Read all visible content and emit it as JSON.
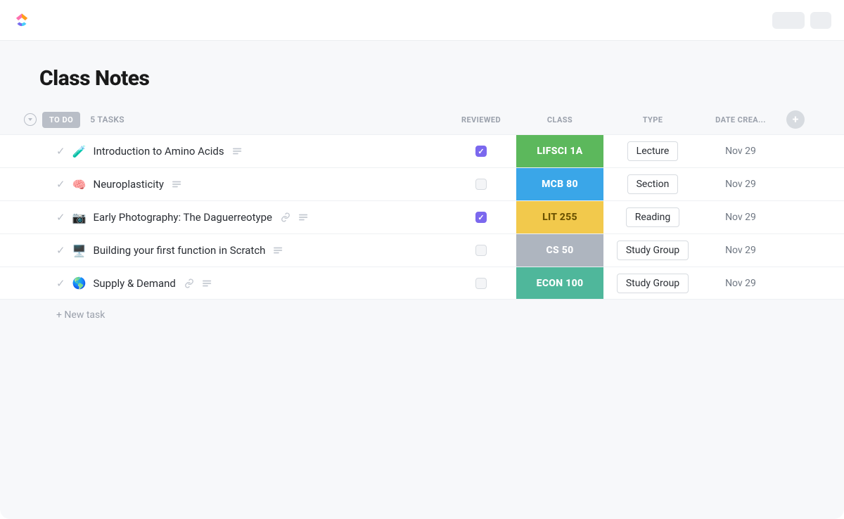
{
  "page": {
    "title": "Class Notes"
  },
  "group": {
    "status_label": "TO DO",
    "task_count": "5 TASKS",
    "new_task_label": "+ New task"
  },
  "columns": {
    "reviewed": "REVIEWED",
    "class": "CLASS",
    "type": "TYPE",
    "date": "DATE CREA..."
  },
  "tasks": [
    {
      "emoji": "🧪",
      "title": "Introduction to Amino Acids",
      "has_doc": true,
      "has_link": false,
      "reviewed": true,
      "class": {
        "label": "LIFSCI 1A",
        "bg": "#5cb85c",
        "fg": "#ffffff"
      },
      "type": "Lecture",
      "date": "Nov 29"
    },
    {
      "emoji": "🧠",
      "title": "Neuroplasticity",
      "has_doc": true,
      "has_link": false,
      "reviewed": false,
      "class": {
        "label": "MCB 80",
        "bg": "#3aa6e8",
        "fg": "#ffffff"
      },
      "type": "Section",
      "date": "Nov 29"
    },
    {
      "emoji": "📷",
      "title": "Early Photography: The Daguerreotype",
      "has_doc": true,
      "has_link": true,
      "reviewed": true,
      "class": {
        "label": "LIT 255",
        "bg": "#f2c94c",
        "fg": "#6b5200"
      },
      "type": "Reading",
      "date": "Nov 29"
    },
    {
      "emoji": "🖥️",
      "title": "Building your first function in Scratch",
      "has_doc": true,
      "has_link": false,
      "reviewed": false,
      "class": {
        "label": "CS 50",
        "bg": "#aeb5bf",
        "fg": "#ffffff"
      },
      "type": "Study Group",
      "date": "Nov 29"
    },
    {
      "emoji": "🌎",
      "title": "Supply & Demand",
      "has_doc": true,
      "has_link": true,
      "reviewed": false,
      "class": {
        "label": "ECON 100",
        "bg": "#4fb79b",
        "fg": "#ffffff"
      },
      "type": "Study Group",
      "date": "Nov 29"
    }
  ]
}
